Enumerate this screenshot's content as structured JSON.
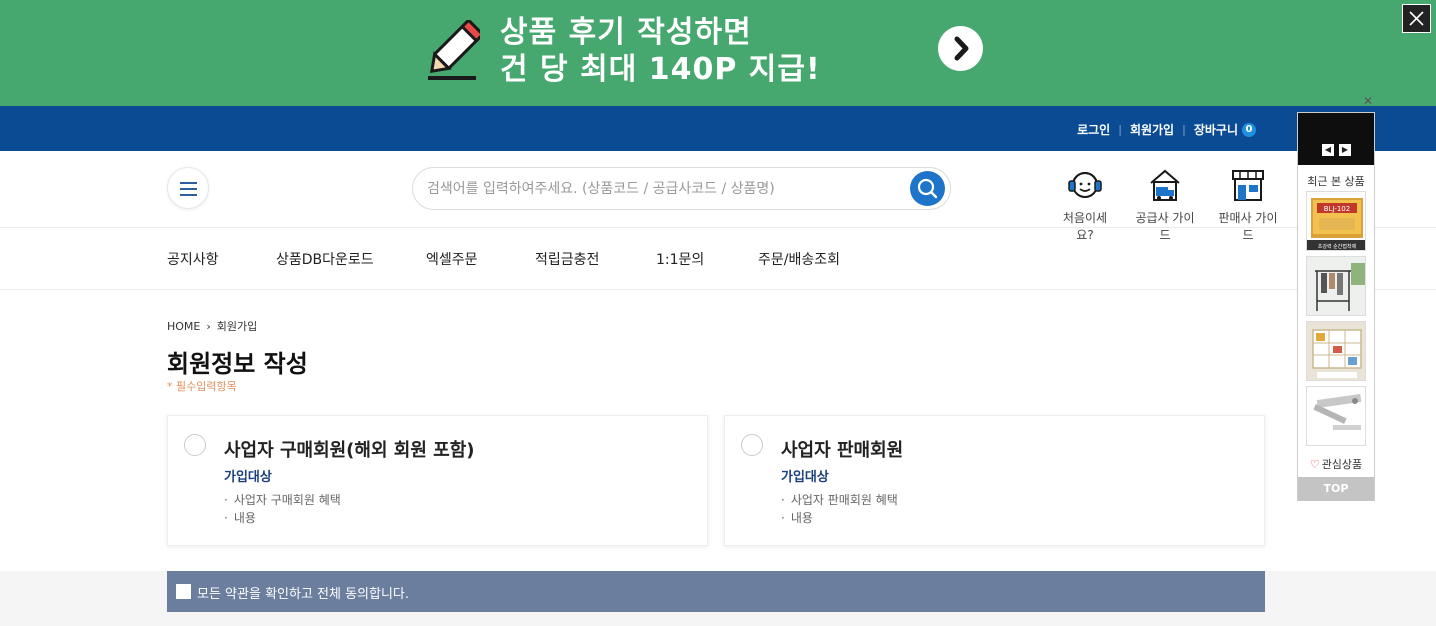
{
  "banner": {
    "line1": "상품 후기 작성하면",
    "line2": "건 당 최대 140P 지급!",
    "colors": {
      "background": "#46a86e",
      "text": "#ffffff"
    },
    "icons": {
      "pencil": "pencil-icon",
      "arrow": "arrow-right-circle-icon",
      "close": "close-icon"
    }
  },
  "topbar": {
    "login": "로그인",
    "signup": "회원가입",
    "cart": "장바구니",
    "cart_count": "0",
    "colors": {
      "background": "#0a4b94",
      "badge": "#1f8fe0"
    }
  },
  "header": {
    "search_placeholder": "검색어를 입력하여주세요. (상품코드 / 공급사코드 / 상품명)",
    "guides": [
      {
        "label": "처음이세요?",
        "icon": "headset-icon"
      },
      {
        "label": "공급사 가이드",
        "icon": "delivery-house-icon"
      },
      {
        "label": "판매사 가이드",
        "icon": "storefront-icon"
      }
    ]
  },
  "gnb": [
    "공지사항",
    "상품DB다운로드",
    "엑셀주문",
    "적립금충전",
    "1:1문의",
    "주문/배송조회"
  ],
  "breadcrumb": {
    "home": "HOME",
    "current": "회원가입"
  },
  "page": {
    "title": "회원정보 작성",
    "required_note": "* 필수입력항목"
  },
  "cards": [
    {
      "title": "사업자 구매회원(해외 회원 포함)",
      "subtitle": "가입대상",
      "items": [
        "사업자 구매회원 혜택",
        "내용"
      ]
    },
    {
      "title": "사업자 판매회원",
      "subtitle": "가입대상",
      "items": [
        "사업자 판매회원 혜택",
        "내용"
      ]
    }
  ],
  "agree": {
    "label": "모든 약관을 확인하고 전체 동의합니다.",
    "color": "#6b7e9e"
  },
  "quick": {
    "recent_label": "최근 본 상품",
    "product_badge": "BLJ-102",
    "product_caption": "초강력 순간접착제",
    "wishlist_label": "관심상품",
    "top_label": "TOP"
  }
}
